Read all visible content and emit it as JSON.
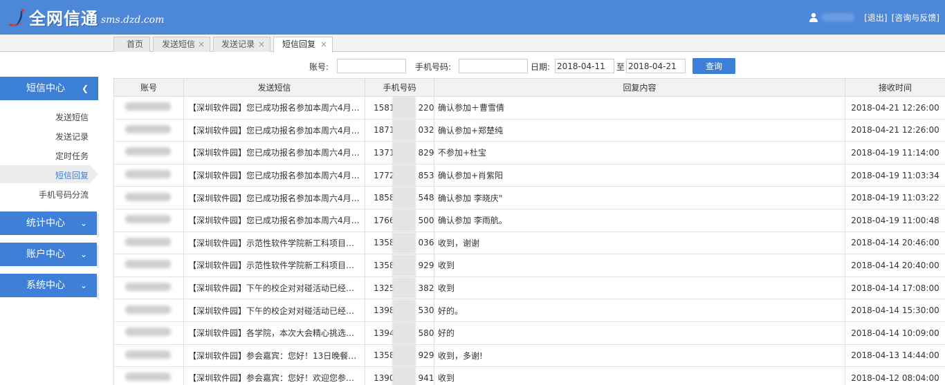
{
  "header": {
    "logo_text": "全网信通",
    "logo_url": "sms.dzd.com",
    "logout": "[退出]",
    "feedback": "[咨询与反馈]",
    "bg_color": "#4d87d8"
  },
  "tabs": [
    {
      "label": "首页",
      "closable": false
    },
    {
      "label": "发送短信",
      "closable": true
    },
    {
      "label": "发送记录",
      "closable": true
    },
    {
      "label": "短信回复",
      "closable": true,
      "active": true
    }
  ],
  "close_glyph": "×",
  "search": {
    "account_label": "账号:",
    "account_value": "",
    "phone_label": "手机号码:",
    "phone_value": "",
    "date_label": "日期:",
    "date_from": "2018-04-11",
    "to_label": "至",
    "date_to": "2018-04-21",
    "query_button": "查询"
  },
  "sidebar": {
    "sms_center": "短信中心",
    "sms_items": [
      "发送短信",
      "发送记录",
      "定时任务",
      "短信回复",
      "手机号码分流"
    ],
    "active_item": "短信回复",
    "stats_center": "统计中心",
    "account_center": "账户中心",
    "system_center": "系统中心",
    "accent_color": "#3b7fd6"
  },
  "table": {
    "columns": [
      "账号",
      "发送短信",
      "手机号码",
      "回复内容",
      "接收时间"
    ],
    "rows": [
      {
        "message": "【深圳软件园】您已成功报名参加本周六4月…",
        "phone_prefix": "1581",
        "phone_suffix": "220",
        "reply": "确认参加＋曹雪倩",
        "time": "2018-04-21 12:26:00"
      },
      {
        "message": "【深圳软件园】您已成功报名参加本周六4月…",
        "phone_prefix": "1871",
        "phone_suffix": "032",
        "reply": "确认参加+郑楚纯",
        "time": "2018-04-21 12:26:00"
      },
      {
        "message": "【深圳软件园】您已成功报名参加本周六4月…",
        "phone_prefix": "1371",
        "phone_suffix": "829",
        "reply": "不参加+杜宝",
        "time": "2018-04-19 11:14:00"
      },
      {
        "message": "【深圳软件园】您已成功报名参加本周六4月…",
        "phone_prefix": "1772",
        "phone_suffix": "853",
        "reply": "确认参加+肖紫阳",
        "time": "2018-04-19 11:03:34"
      },
      {
        "message": "【深圳软件园】您已成功报名参加本周六4月…",
        "phone_prefix": "1858",
        "phone_suffix": "548",
        "reply": "确认参加 李晓庆\"",
        "time": "2018-04-19 11:03:22"
      },
      {
        "message": "【深圳软件园】您已成功报名参加本周六4月…",
        "phone_prefix": "1766",
        "phone_suffix": "500",
        "reply": "确认参加 李雨航。",
        "time": "2018-04-19 11:00:48"
      },
      {
        "message": "【深圳软件园】示范性软件学院新工科项目…",
        "phone_prefix": "1358",
        "phone_suffix": "036",
        "reply": "收到，谢谢",
        "time": "2018-04-14 20:46:00"
      },
      {
        "message": "【深圳软件园】示范性软件学院新工科项目…",
        "phone_prefix": "1358",
        "phone_suffix": "929",
        "reply": "收到",
        "time": "2018-04-14 20:40:00"
      },
      {
        "message": "【深圳软件园】下午的校企对对碰活动已经…",
        "phone_prefix": "1325",
        "phone_suffix": "382",
        "reply": "收到",
        "time": "2018-04-14 17:08:00"
      },
      {
        "message": "【深圳软件园】下午的校企对对碰活动已经…",
        "phone_prefix": "1398",
        "phone_suffix": "530",
        "reply": "好的。",
        "time": "2018-04-14 15:30:00"
      },
      {
        "message": "【深圳软件园】各学院，本次大会精心挑选…",
        "phone_prefix": "1394",
        "phone_suffix": "580",
        "reply": "好的",
        "time": "2018-04-14 10:09:00"
      },
      {
        "message": "【深圳软件园】参会嘉宾：您好！13日晚餐…",
        "phone_prefix": "1358",
        "phone_suffix": "929",
        "reply": "收到，多谢!",
        "time": "2018-04-13 14:44:00"
      },
      {
        "message": "【深圳软件园】参会嘉宾：您好！欢迎您参…",
        "phone_prefix": "1390",
        "phone_suffix": "941",
        "reply": "收到",
        "time": "2018-04-12 08:04:00"
      }
    ]
  }
}
